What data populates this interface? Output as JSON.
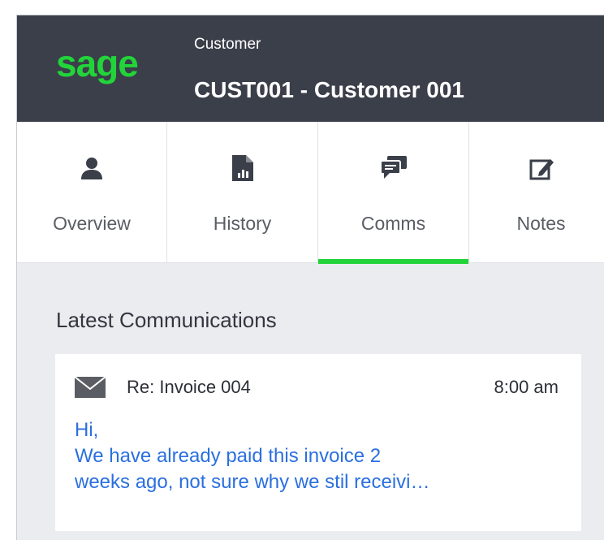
{
  "header": {
    "logo_text": "sage",
    "entity_type": "Customer",
    "entity_title": "CUST001 - Customer 001"
  },
  "tabs": [
    {
      "label": "Overview",
      "icon": "person-icon",
      "active": false
    },
    {
      "label": "History",
      "icon": "report-chart-icon",
      "active": false
    },
    {
      "label": "Comms",
      "icon": "chat-bubbles-icon",
      "active": true
    },
    {
      "label": "Notes",
      "icon": "edit-note-icon",
      "active": false
    }
  ],
  "content": {
    "section_title": "Latest Communications",
    "message": {
      "icon": "envelope-icon",
      "subject": "Re: Invoice 004",
      "time": "8:00 am",
      "body_lines": [
        "Hi,",
        "We have already paid this invoice 2",
        "weeks ago, not sure why we stil receivi…"
      ]
    }
  },
  "colors": {
    "header_bg": "#3b3f4a",
    "brand_green": "#22d43a",
    "link_blue": "#2a6fe0",
    "content_bg": "#ebecef"
  }
}
